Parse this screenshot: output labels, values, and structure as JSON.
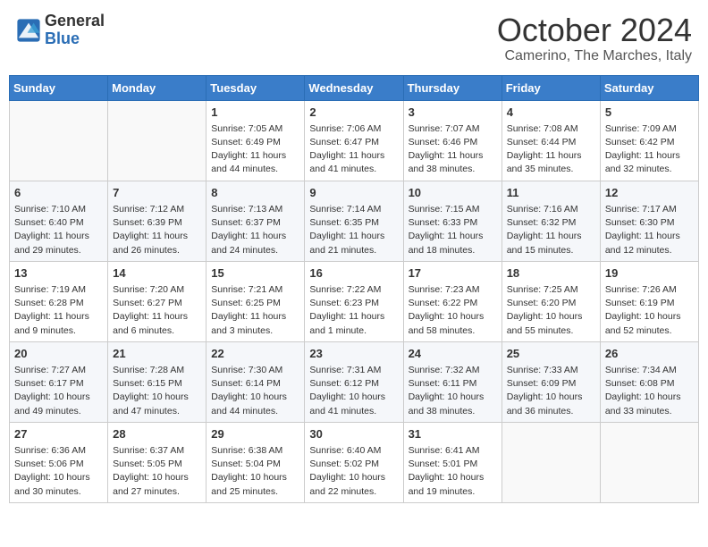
{
  "logo": {
    "general": "General",
    "blue": "Blue"
  },
  "title": "October 2024",
  "location": "Camerino, The Marches, Italy",
  "weekdays": [
    "Sunday",
    "Monday",
    "Tuesday",
    "Wednesday",
    "Thursday",
    "Friday",
    "Saturday"
  ],
  "weeks": [
    [
      {
        "day": "",
        "info": ""
      },
      {
        "day": "",
        "info": ""
      },
      {
        "day": "1",
        "info": "Sunrise: 7:05 AM\nSunset: 6:49 PM\nDaylight: 11 hours and 44 minutes."
      },
      {
        "day": "2",
        "info": "Sunrise: 7:06 AM\nSunset: 6:47 PM\nDaylight: 11 hours and 41 minutes."
      },
      {
        "day": "3",
        "info": "Sunrise: 7:07 AM\nSunset: 6:46 PM\nDaylight: 11 hours and 38 minutes."
      },
      {
        "day": "4",
        "info": "Sunrise: 7:08 AM\nSunset: 6:44 PM\nDaylight: 11 hours and 35 minutes."
      },
      {
        "day": "5",
        "info": "Sunrise: 7:09 AM\nSunset: 6:42 PM\nDaylight: 11 hours and 32 minutes."
      }
    ],
    [
      {
        "day": "6",
        "info": "Sunrise: 7:10 AM\nSunset: 6:40 PM\nDaylight: 11 hours and 29 minutes."
      },
      {
        "day": "7",
        "info": "Sunrise: 7:12 AM\nSunset: 6:39 PM\nDaylight: 11 hours and 26 minutes."
      },
      {
        "day": "8",
        "info": "Sunrise: 7:13 AM\nSunset: 6:37 PM\nDaylight: 11 hours and 24 minutes."
      },
      {
        "day": "9",
        "info": "Sunrise: 7:14 AM\nSunset: 6:35 PM\nDaylight: 11 hours and 21 minutes."
      },
      {
        "day": "10",
        "info": "Sunrise: 7:15 AM\nSunset: 6:33 PM\nDaylight: 11 hours and 18 minutes."
      },
      {
        "day": "11",
        "info": "Sunrise: 7:16 AM\nSunset: 6:32 PM\nDaylight: 11 hours and 15 minutes."
      },
      {
        "day": "12",
        "info": "Sunrise: 7:17 AM\nSunset: 6:30 PM\nDaylight: 11 hours and 12 minutes."
      }
    ],
    [
      {
        "day": "13",
        "info": "Sunrise: 7:19 AM\nSunset: 6:28 PM\nDaylight: 11 hours and 9 minutes."
      },
      {
        "day": "14",
        "info": "Sunrise: 7:20 AM\nSunset: 6:27 PM\nDaylight: 11 hours and 6 minutes."
      },
      {
        "day": "15",
        "info": "Sunrise: 7:21 AM\nSunset: 6:25 PM\nDaylight: 11 hours and 3 minutes."
      },
      {
        "day": "16",
        "info": "Sunrise: 7:22 AM\nSunset: 6:23 PM\nDaylight: 11 hours and 1 minute."
      },
      {
        "day": "17",
        "info": "Sunrise: 7:23 AM\nSunset: 6:22 PM\nDaylight: 10 hours and 58 minutes."
      },
      {
        "day": "18",
        "info": "Sunrise: 7:25 AM\nSunset: 6:20 PM\nDaylight: 10 hours and 55 minutes."
      },
      {
        "day": "19",
        "info": "Sunrise: 7:26 AM\nSunset: 6:19 PM\nDaylight: 10 hours and 52 minutes."
      }
    ],
    [
      {
        "day": "20",
        "info": "Sunrise: 7:27 AM\nSunset: 6:17 PM\nDaylight: 10 hours and 49 minutes."
      },
      {
        "day": "21",
        "info": "Sunrise: 7:28 AM\nSunset: 6:15 PM\nDaylight: 10 hours and 47 minutes."
      },
      {
        "day": "22",
        "info": "Sunrise: 7:30 AM\nSunset: 6:14 PM\nDaylight: 10 hours and 44 minutes."
      },
      {
        "day": "23",
        "info": "Sunrise: 7:31 AM\nSunset: 6:12 PM\nDaylight: 10 hours and 41 minutes."
      },
      {
        "day": "24",
        "info": "Sunrise: 7:32 AM\nSunset: 6:11 PM\nDaylight: 10 hours and 38 minutes."
      },
      {
        "day": "25",
        "info": "Sunrise: 7:33 AM\nSunset: 6:09 PM\nDaylight: 10 hours and 36 minutes."
      },
      {
        "day": "26",
        "info": "Sunrise: 7:34 AM\nSunset: 6:08 PM\nDaylight: 10 hours and 33 minutes."
      }
    ],
    [
      {
        "day": "27",
        "info": "Sunrise: 6:36 AM\nSunset: 5:06 PM\nDaylight: 10 hours and 30 minutes."
      },
      {
        "day": "28",
        "info": "Sunrise: 6:37 AM\nSunset: 5:05 PM\nDaylight: 10 hours and 27 minutes."
      },
      {
        "day": "29",
        "info": "Sunrise: 6:38 AM\nSunset: 5:04 PM\nDaylight: 10 hours and 25 minutes."
      },
      {
        "day": "30",
        "info": "Sunrise: 6:40 AM\nSunset: 5:02 PM\nDaylight: 10 hours and 22 minutes."
      },
      {
        "day": "31",
        "info": "Sunrise: 6:41 AM\nSunset: 5:01 PM\nDaylight: 10 hours and 19 minutes."
      },
      {
        "day": "",
        "info": ""
      },
      {
        "day": "",
        "info": ""
      }
    ]
  ]
}
